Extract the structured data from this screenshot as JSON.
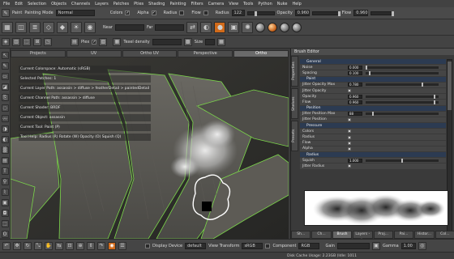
{
  "menubar": {
    "items": [
      "File",
      "Edit",
      "Selection",
      "Objects",
      "Channels",
      "Layers",
      "Patches",
      "Pties",
      "Shading",
      "Painting",
      "Filters",
      "Camera",
      "View",
      "Tools",
      "Python",
      "Nuke",
      "Help"
    ]
  },
  "paint_toolbar": {
    "paint_label": "Paint",
    "mode_label": "Painting Mode",
    "mode_value": "Normal",
    "colors_label": "Colors",
    "alpha_label": "Alpha",
    "radius_label": "Radius",
    "flow_label": "Flow",
    "radius2_label": "Radius",
    "radius_value": "122",
    "opacity_label": "Opacity",
    "opacity_value": "0.960",
    "flow2_label": "Flow",
    "flow_value": "0.960"
  },
  "toolbar2": {
    "near_label": "Near",
    "far_label": "Far"
  },
  "toolbar3": {
    "plex_label": "Plex",
    "texel_label": "Texel density",
    "size_label": "Size"
  },
  "viewport": {
    "tabs": [
      "Projects",
      "UV",
      "Ortho UV",
      "Perspective",
      "Ortho"
    ],
    "hud": [
      "Current Colorspace: Automatic (sRGB)",
      "Selected Patches: 1",
      "Current Layer Path: assassin > diffuse > featherDetail > paintedDetail",
      "Current Channel Path: assassin > diffuse",
      "Current Shader: BRDF",
      "Current Object: assassin",
      "Current Tool: Paint (P)",
      "Tool Help: Radius (R) Rotate (W) Opacity (O) Squish (Q)"
    ]
  },
  "brush_editor": {
    "title": "Brush Editor",
    "side_tabs": [
      "Properties",
      "Shelves",
      "Presets"
    ],
    "rows": [
      {
        "type": "group",
        "name": "General"
      },
      {
        "type": "value",
        "name": "Noise",
        "value": "0.000",
        "fill": 0.0
      },
      {
        "type": "value",
        "name": "Spacing",
        "value": "0.100",
        "fill": 0.05
      },
      {
        "type": "group",
        "name": "Paint"
      },
      {
        "type": "value",
        "name": "Jitter Opacity Max",
        "value": "0.780",
        "fill": 0.78
      },
      {
        "type": "check",
        "name": "Jitter Opacity"
      },
      {
        "type": "value",
        "name": "Opacity",
        "value": "0.960",
        "fill": 0.96
      },
      {
        "type": "value",
        "name": "Flow",
        "value": "0.960",
        "fill": 0.96
      },
      {
        "type": "group",
        "name": "Position"
      },
      {
        "type": "value",
        "name": "Jitter Position Max",
        "value": "88",
        "fill": 0.09
      },
      {
        "type": "check",
        "name": "Jitter Position"
      },
      {
        "type": "group",
        "name": "Pressure"
      },
      {
        "type": "check",
        "name": "Colors"
      },
      {
        "type": "check",
        "name": "Radius"
      },
      {
        "type": "check",
        "name": "Flow"
      },
      {
        "type": "check",
        "name": "Alpha"
      },
      {
        "type": "group",
        "name": "Radius"
      },
      {
        "type": "value",
        "name": "Squish",
        "value": "1.000",
        "fill": 0.5
      },
      {
        "type": "check",
        "name": "Jitter Radius"
      }
    ],
    "bottom_tabs": [
      "Sh...",
      "Ch...",
      "Brush",
      "Layers - d...",
      "Proj...",
      "Pai...",
      "Histor...",
      "Col..."
    ]
  },
  "bottom_toolbar": {
    "display_device_label": "Display Device",
    "display_device_value": "default",
    "view_transform_label": "View Transform",
    "view_transform_value": "sRGB",
    "component_label": "Component",
    "component_value": "RGB",
    "gain_label": "Gain",
    "gamma_label": "Gamma",
    "gamma_value": "1.00"
  },
  "status": {
    "text": "Disk Cache Usage: 2.23GB (Idle: 1011"
  }
}
